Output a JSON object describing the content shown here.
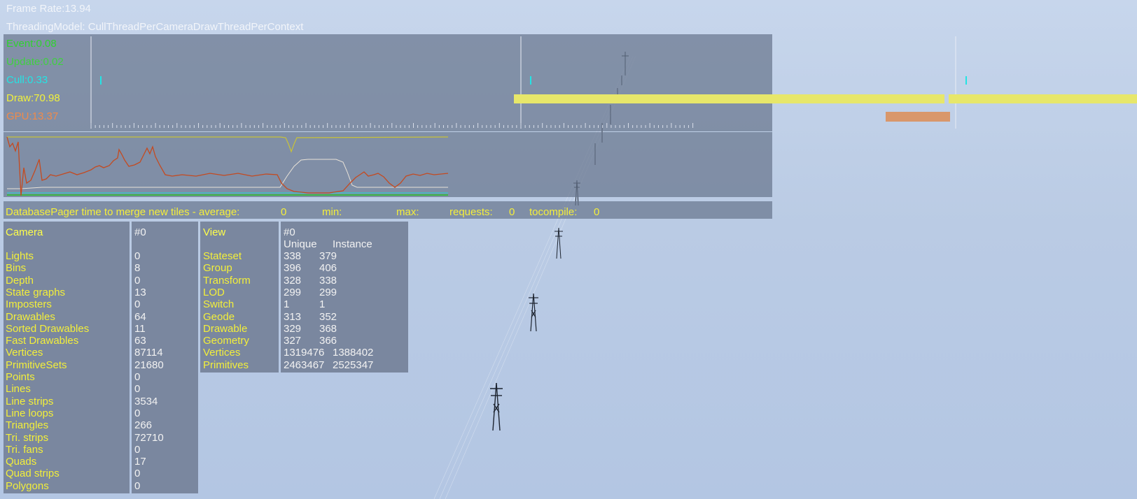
{
  "header": {
    "frame_rate": "Frame Rate:13.94",
    "threading_model": "ThreadingModel: CullThreadPerCameraDrawThreadPerContext"
  },
  "timing": {
    "event": "Event:0.08",
    "update": "Update:0.02",
    "cull": "Cull:0.33",
    "draw": "Draw:70.98",
    "gpu": "GPU:13.37"
  },
  "colors": {
    "event": "#2fd22f",
    "update": "#3fd13f",
    "cull": "#23e4e4",
    "draw": "#f2f23a",
    "gpu": "#f08a4a",
    "panel": "#6a778f",
    "table_label": "#f3ef3a",
    "table_value": "#f2f2f2"
  },
  "pager": {
    "label": "DatabasePager time to merge new tiles - average:",
    "average": "0",
    "min_label": "min:",
    "max_label": "max:",
    "requests_label": "requests:",
    "requests": "0",
    "tocompile_label": "tocompile:",
    "tocompile": "0"
  },
  "camera": {
    "title": "Camera",
    "id": "#0",
    "rows": [
      {
        "label": "Lights",
        "value": "0"
      },
      {
        "label": "Bins",
        "value": "8"
      },
      {
        "label": "Depth",
        "value": "0"
      },
      {
        "label": "State graphs",
        "value": "13"
      },
      {
        "label": "Imposters",
        "value": "0"
      },
      {
        "label": "Drawables",
        "value": "64"
      },
      {
        "label": "Sorted Drawables",
        "value": "11"
      },
      {
        "label": "Fast Drawables",
        "value": "63"
      },
      {
        "label": "Vertices",
        "value": "87114"
      },
      {
        "label": "PrimitiveSets",
        "value": "21680"
      },
      {
        "label": "Points",
        "value": "0"
      },
      {
        "label": "Lines",
        "value": "0"
      },
      {
        "label": "Line strips",
        "value": "3534"
      },
      {
        "label": "Line loops",
        "value": "0"
      },
      {
        "label": "Triangles",
        "value": "266"
      },
      {
        "label": "Tri. strips",
        "value": "72710"
      },
      {
        "label": "Tri. fans",
        "value": "0"
      },
      {
        "label": "Quads",
        "value": "17"
      },
      {
        "label": "Quad strips",
        "value": "0"
      },
      {
        "label": "Polygons",
        "value": "0"
      }
    ]
  },
  "view": {
    "title": "View",
    "id": "#0",
    "col_unique": "Unique",
    "col_instance": "Instance",
    "rows": [
      {
        "label": "Stateset",
        "unique": "338",
        "instance": "379"
      },
      {
        "label": "Group",
        "unique": "396",
        "instance": "406"
      },
      {
        "label": "Transform",
        "unique": "328",
        "instance": "338"
      },
      {
        "label": "LOD",
        "unique": "299",
        "instance": "299"
      },
      {
        "label": "Switch",
        "unique": "1",
        "instance": "1"
      },
      {
        "label": "Geode",
        "unique": "313",
        "instance": "352"
      },
      {
        "label": "Drawable",
        "unique": "329",
        "instance": "368"
      },
      {
        "label": "Geometry",
        "unique": "327",
        "instance": "366"
      },
      {
        "label": "Vertices",
        "unique": "1319476",
        "instance": "1388402"
      },
      {
        "label": "Primitives",
        "unique": "2463467",
        "instance": "2525347"
      }
    ]
  }
}
